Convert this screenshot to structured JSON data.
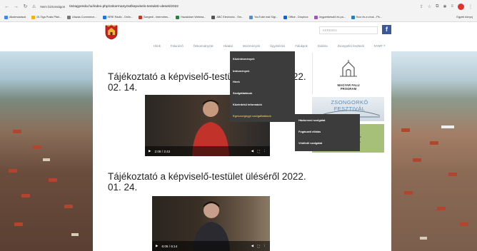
{
  "browser": {
    "url": "tiszagyenda.hu/index.php/onkormanyzat/kepviselo-testuleti-ulesek/2022",
    "url_prefix": "Nem biztonságos",
    "bookmarks": [
      {
        "label": "Alkalmazások",
        "color": "#4285f4"
      },
      {
        "label": "DI-Tiga Posts Pfall...",
        "color": "#f4b400"
      },
      {
        "label": "Utazás Commerce...",
        "color": "#777777"
      },
      {
        "label": "HÍRE Rádió - Onlin...",
        "color": "#1a73e8"
      },
      {
        "label": "Szegedi - Internetes...",
        "color": "#c0392b"
      },
      {
        "label": "Hazaköser Webina...",
        "color": "#2d7d46"
      },
      {
        "label": "ABC Electronic - Sm...",
        "color": "#555555"
      },
      {
        "label": "YouTube mai SIgl...",
        "color": "#4e8fd8"
      },
      {
        "label": "Office - Dropbox",
        "color": "#0061ff"
      },
      {
        "label": "Jegyzetkészlő és pa...",
        "color": "#9b59b6"
      },
      {
        "label": "Kvíz és a vírus - Pk...",
        "color": "#2980b9"
      }
    ],
    "other_bookmarks": "Egyéb könyvj"
  },
  "header": {
    "search_placeholder": "KERESÉS",
    "facebook_label": "f"
  },
  "nav": {
    "items": [
      "Hírek",
      "Falunéző",
      "Önkormányzat",
      "Hivatal",
      "Intézmények",
      "Ügyintézés",
      "Falukpok",
      "Galéria",
      "Zsongorkó fesztivál",
      "NYMT 7"
    ]
  },
  "dropdown": {
    "items": [
      "Közintézmények",
      "Intézmények",
      "Hírek",
      "Szolgáltatások",
      "Közérdekű információ",
      "Egészségügyi szolgáltatások"
    ],
    "active_index": 5
  },
  "submenu": {
    "items": [
      "Háziorvosi szolgálat",
      "Fogászati ellátás",
      "Védőnői szolgálat"
    ]
  },
  "posts": [
    {
      "title": "Tájékoztató a képviselő-testület üléséről 2022. 02. 14.",
      "time": "2:08 / 2:42"
    },
    {
      "title": "Tájékoztató a képviselő-testület üléséről 2022. 01. 24.",
      "time": "6:05 / 6:14"
    }
  ],
  "sidebar": {
    "mfp_label_1": "MAGYAR FALU",
    "mfp_label_2": "PROGRAM",
    "zsongorko_label": "ZSONGORKÓ FESZTIVÁL",
    "green_text": "ntlt"
  },
  "colors": {
    "menu_bg": "#3c3c3c",
    "menu_active": "#d6b25e",
    "facebook": "#3b5998",
    "nav_text": "#7a8a92"
  }
}
